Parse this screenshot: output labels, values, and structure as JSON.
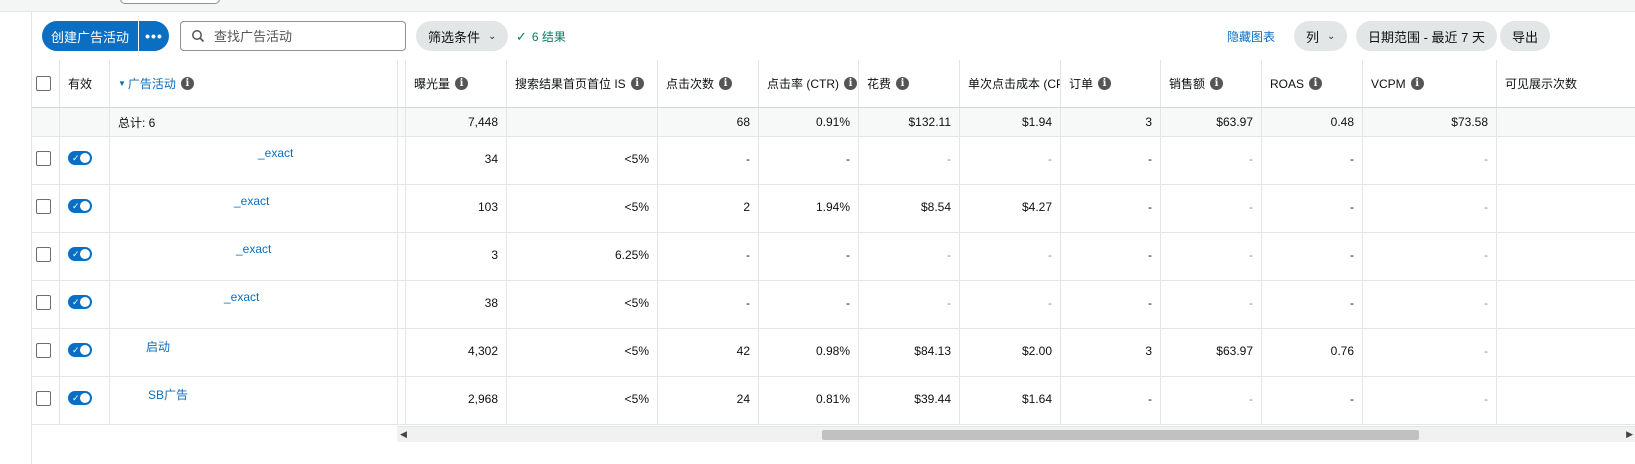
{
  "toolbar": {
    "create_label": "创建广告活动",
    "more_label": "•••",
    "search_placeholder": "查找广告活动",
    "filter_label": "筛选条件",
    "results_label": "6 结果",
    "hide_chart_label": "隐藏图表",
    "columns_label": "列",
    "date_range_label": "日期范围 - 最近 7 天",
    "export_label": "导出"
  },
  "columns": {
    "active": "有效",
    "campaign": "广告活动",
    "impressions": "曝光量",
    "top_of_search_is": "搜索结果首页首位 IS",
    "clicks": "点击次数",
    "ctr": "点击率 (CTR)",
    "spend": "花费",
    "cpc": "单次点击成本 (CPC)",
    "orders": "订单",
    "sales": "销售额",
    "roas": "ROAS",
    "vcpm": "VCPM",
    "viewable": "可见展示次数"
  },
  "totals": {
    "label": "总计: 6",
    "impressions": "7,448",
    "top_of_search_is": "",
    "clicks": "68",
    "ctr": "0.91%",
    "spend": "$132.11",
    "cpc": "$1.94",
    "orders": "3",
    "sales": "$63.97",
    "roas": "0.48",
    "vcpm": "$73.58"
  },
  "rows": [
    {
      "name": "_exact",
      "impressions": "34",
      "top_of_search_is": "<5%",
      "clicks": "-",
      "ctr": "-",
      "spend": "-",
      "cpc": "-",
      "orders": "-",
      "sales": "-",
      "roas": "-",
      "vcpm": "-"
    },
    {
      "name": "_exact",
      "impressions": "103",
      "top_of_search_is": "<5%",
      "clicks": "2",
      "ctr": "1.94%",
      "spend": "$8.54",
      "cpc": "$4.27",
      "orders": "-",
      "sales": "-",
      "roas": "-",
      "vcpm": "-"
    },
    {
      "name": "_exact",
      "impressions": "3",
      "top_of_search_is": "6.25%",
      "clicks": "-",
      "ctr": "-",
      "spend": "-",
      "cpc": "-",
      "orders": "-",
      "sales": "-",
      "roas": "-",
      "vcpm": "-"
    },
    {
      "name": "_exact",
      "impressions": "38",
      "top_of_search_is": "<5%",
      "clicks": "-",
      "ctr": "-",
      "spend": "-",
      "cpc": "-",
      "orders": "-",
      "sales": "-",
      "roas": "-",
      "vcpm": "-"
    },
    {
      "name": "启动",
      "impressions": "4,302",
      "top_of_search_is": "<5%",
      "clicks": "42",
      "ctr": "0.98%",
      "spend": "$84.13",
      "cpc": "$2.00",
      "orders": "3",
      "sales": "$63.97",
      "roas": "0.76",
      "vcpm": "-"
    },
    {
      "name": "SB广告",
      "impressions": "2,968",
      "top_of_search_is": "<5%",
      "clicks": "24",
      "ctr": "0.81%",
      "spend": "$39.44",
      "cpc": "$1.64",
      "orders": "-",
      "sales": "-",
      "roas": "-",
      "vcpm": "-"
    }
  ],
  "icons": {
    "search": "search-icon",
    "info": "info-icon",
    "sort": "sort-desc-icon",
    "check": "check-icon"
  },
  "colors": {
    "primary": "#0a6fc2",
    "success": "#067d62"
  }
}
